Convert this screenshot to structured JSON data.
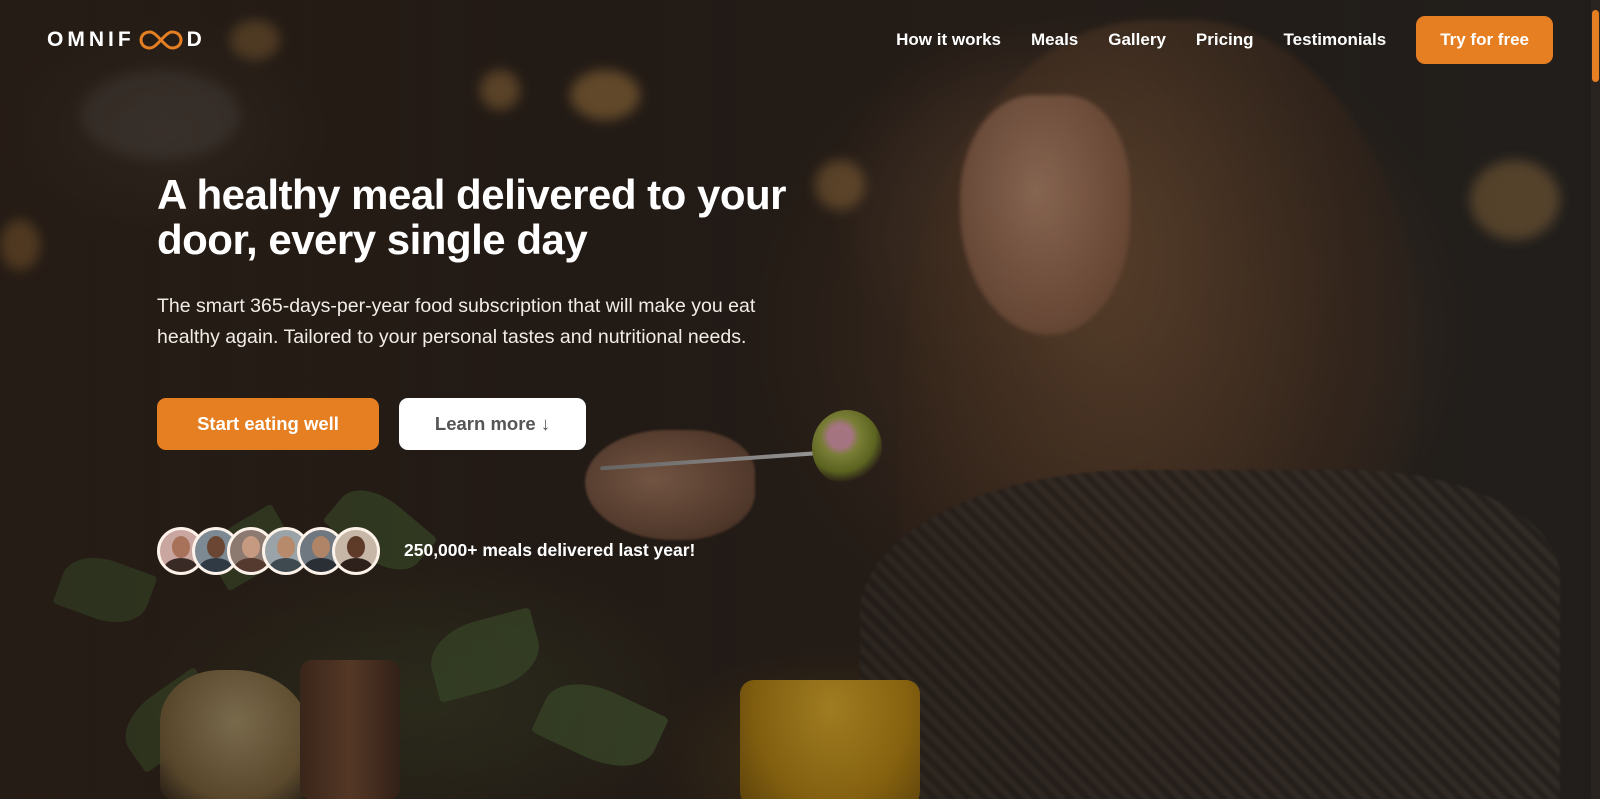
{
  "brand": {
    "name_before": "OMNIF",
    "name_after": "D",
    "accent_color": "#e67e22"
  },
  "nav": {
    "links": [
      {
        "label": "How it works"
      },
      {
        "label": "Meals"
      },
      {
        "label": "Gallery"
      },
      {
        "label": "Pricing"
      },
      {
        "label": "Testimonials"
      }
    ],
    "cta_label": "Try for free"
  },
  "hero": {
    "title": "A healthy meal delivered to your door, every single day",
    "description": "The smart 365-days-per-year food subscription that will make you eat healthy again. Tailored to your personal tastes and nutritional needs.",
    "primary_button": "Start eating well",
    "secondary_button": "Learn more ↓",
    "delivered_text": "250,000+ meals delivered last year!",
    "customer_avatars": [
      "customer-1",
      "customer-2",
      "customer-3",
      "customer-4",
      "customer-5",
      "customer-6"
    ]
  }
}
